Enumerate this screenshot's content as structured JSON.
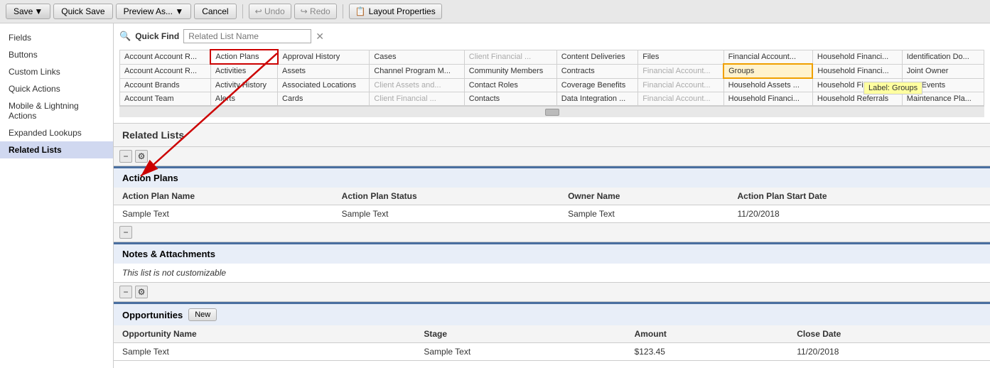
{
  "toolbar": {
    "save_label": "Save",
    "quick_save_label": "Quick Save",
    "preview_label": "Preview As...",
    "cancel_label": "Cancel",
    "undo_label": "↩ Undo",
    "redo_label": "↪ Redo",
    "layout_props_label": "Layout Properties",
    "layout_icon": "📋"
  },
  "sidebar": {
    "items": [
      {
        "label": "Fields",
        "active": false
      },
      {
        "label": "Buttons",
        "active": false
      },
      {
        "label": "Custom Links",
        "active": false
      },
      {
        "label": "Quick Actions",
        "active": false
      },
      {
        "label": "Mobile & Lightning Actions",
        "active": false
      },
      {
        "label": "Expanded Lookups",
        "active": false
      },
      {
        "label": "Related Lists",
        "active": true
      }
    ]
  },
  "quick_find": {
    "label": "Quick Find",
    "placeholder": "Related List Name"
  },
  "grid": {
    "rows": [
      [
        {
          "text": "Account Account R...",
          "state": "normal"
        },
        {
          "text": "Action Plans",
          "state": "selected"
        },
        {
          "text": "Approval History",
          "state": "normal"
        },
        {
          "text": "Cases",
          "state": "normal"
        },
        {
          "text": "Client Financial ...",
          "state": "dimmed"
        },
        {
          "text": "Content Deliveries",
          "state": "normal"
        },
        {
          "text": "Files",
          "state": "normal"
        },
        {
          "text": "Financial Account...",
          "state": "normal"
        },
        {
          "text": "Household Financi...",
          "state": "normal"
        },
        {
          "text": "Identification Do...",
          "state": "normal"
        }
      ],
      [
        {
          "text": "Account Account R...",
          "state": "normal"
        },
        {
          "text": "Activities",
          "state": "normal"
        },
        {
          "text": "Assets",
          "state": "normal"
        },
        {
          "text": "Channel Program M...",
          "state": "normal"
        },
        {
          "text": "Community Members",
          "state": "normal"
        },
        {
          "text": "Contracts",
          "state": "normal"
        },
        {
          "text": "Financial Account...",
          "state": "dimmed"
        },
        {
          "text": "Groups",
          "state": "highlighted"
        },
        {
          "text": "Household Financi...",
          "state": "normal"
        },
        {
          "text": "Joint Owner",
          "state": "normal"
        }
      ],
      [
        {
          "text": "Account Brands",
          "state": "normal"
        },
        {
          "text": "Activity History",
          "state": "normal"
        },
        {
          "text": "Associated Locations",
          "state": "normal"
        },
        {
          "text": "Client Assets and...",
          "state": "dimmed"
        },
        {
          "text": "Contact Roles",
          "state": "normal"
        },
        {
          "text": "Coverage Benefits",
          "state": "normal"
        },
        {
          "text": "Financial Account...",
          "state": "dimmed"
        },
        {
          "text": "Household Assets ...",
          "state": "normal"
        },
        {
          "text": "Household Financi...",
          "state": "normal"
        },
        {
          "text": "Life Events",
          "state": "normal"
        }
      ],
      [
        {
          "text": "Account Team",
          "state": "normal"
        },
        {
          "text": "Alerts",
          "state": "normal"
        },
        {
          "text": "Cards",
          "state": "normal"
        },
        {
          "text": "Client Financial ...",
          "state": "dimmed"
        },
        {
          "text": "Contacts",
          "state": "normal"
        },
        {
          "text": "Data Integration ...",
          "state": "normal"
        },
        {
          "text": "Financial Account...",
          "state": "dimmed"
        },
        {
          "text": "Household Financi...",
          "state": "normal"
        },
        {
          "text": "Household Referrals",
          "state": "normal"
        },
        {
          "text": "Maintenance Pla...",
          "state": "normal"
        }
      ]
    ]
  },
  "label_tooltip": "Label: Groups",
  "related_lists_section": {
    "title": "Related Lists"
  },
  "action_plans_section": {
    "title": "Action Plans",
    "columns": [
      "Action Plan Name",
      "Action Plan Status",
      "Owner Name",
      "Action Plan Start Date"
    ],
    "rows": [
      [
        "Sample Text",
        "Sample Text",
        "Sample Text",
        "11/20/2018"
      ]
    ]
  },
  "notes_section": {
    "title": "Notes & Attachments",
    "not_customizable": "This list is not customizable"
  },
  "opportunities_section": {
    "title": "Opportunities",
    "new_btn": "New",
    "columns": [
      "Opportunity Name",
      "Stage",
      "Amount",
      "Close Date"
    ],
    "rows": [
      [
        "Sample Text",
        "Sample Text",
        "$123.45",
        "11/20/2018"
      ]
    ]
  }
}
